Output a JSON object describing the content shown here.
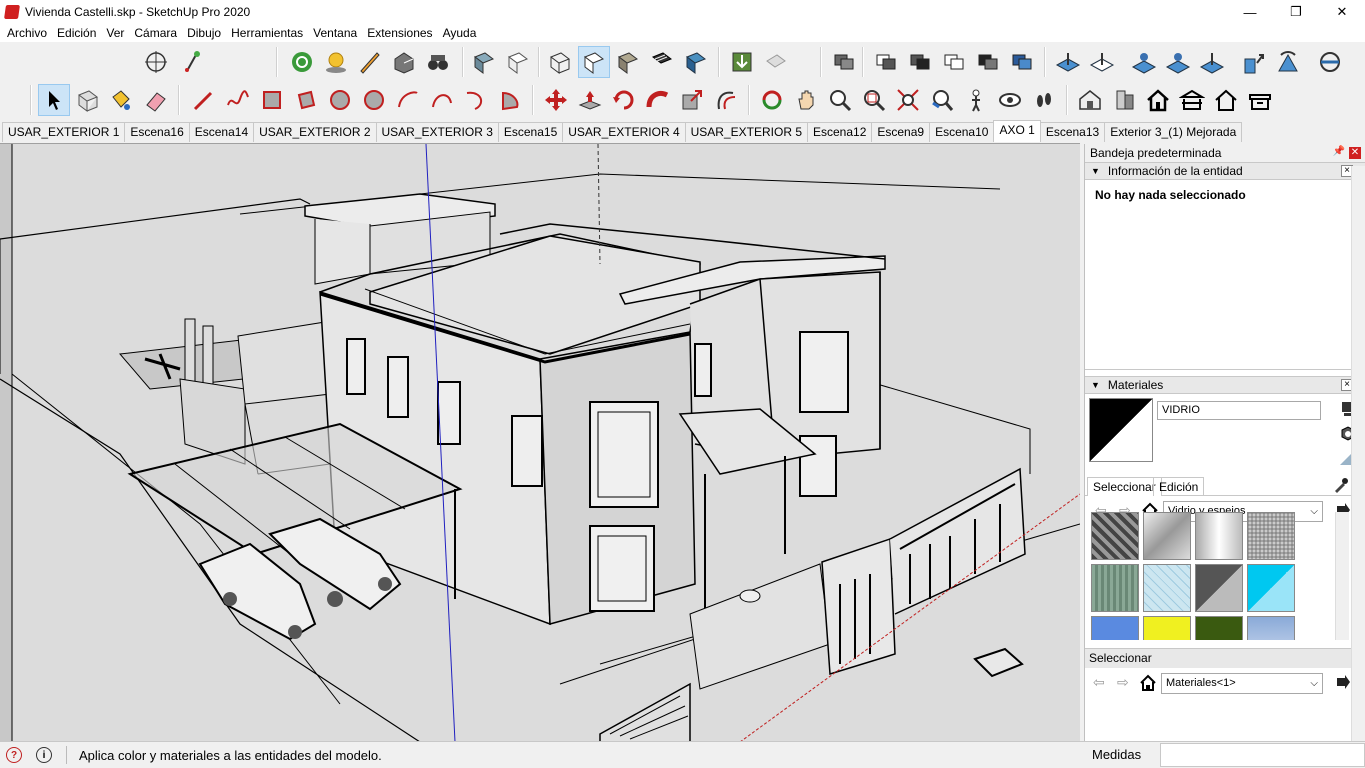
{
  "window": {
    "title": "Vivienda Castelli.skp - SketchUp Pro 2020",
    "minimize": "—",
    "maximize": "❐",
    "close": "✕"
  },
  "menu": [
    "Archivo",
    "Edición",
    "Ver",
    "Cámara",
    "Dibujo",
    "Herramientas",
    "Ventana",
    "Extensiones",
    "Ayuda"
  ],
  "scenes": [
    {
      "label": "USAR_EXTERIOR 1",
      "active": false
    },
    {
      "label": "Escena16",
      "active": false
    },
    {
      "label": "Escena14",
      "active": false
    },
    {
      "label": "USAR_EXTERIOR 2",
      "active": false
    },
    {
      "label": "USAR_EXTERIOR 3",
      "active": false
    },
    {
      "label": "Escena15",
      "active": false
    },
    {
      "label": "USAR_EXTERIOR 4",
      "active": false
    },
    {
      "label": "USAR_EXTERIOR 5",
      "active": false
    },
    {
      "label": "Escena12",
      "active": false
    },
    {
      "label": "Escena9",
      "active": false
    },
    {
      "label": "Escena10",
      "active": false
    },
    {
      "label": "AXO 1",
      "active": true
    },
    {
      "label": "Escena13",
      "active": false
    },
    {
      "label": "Exterior 3_(1) Mejorada",
      "active": false
    }
  ],
  "tray": {
    "title": "Bandeja predeterminada",
    "pin": "📌",
    "close": "✕",
    "entity_info": {
      "header": "Información de la entidad",
      "close": "×",
      "body": "No hay nada seleccionado"
    },
    "materials": {
      "header": "Materiales",
      "close": "×",
      "current_name": "VIDRIO",
      "tab_select": "Seleccionar",
      "tab_edit": "Edición",
      "library": "Vidrio y espejos",
      "second_select_label": "Seleccionar",
      "second_library": "Materiales<1>"
    }
  },
  "status": {
    "message": "Aplica color y materiales a las entidades del modelo.",
    "measure_label": "Medidas",
    "info_icon_1": "?",
    "info_icon_2": "i"
  },
  "colors": {
    "viewport_bg": "#dcdcdc",
    "selected_tool_bg": "#cce4f7",
    "axis_blue": "#2020c0",
    "axis_red": "#c02020"
  }
}
